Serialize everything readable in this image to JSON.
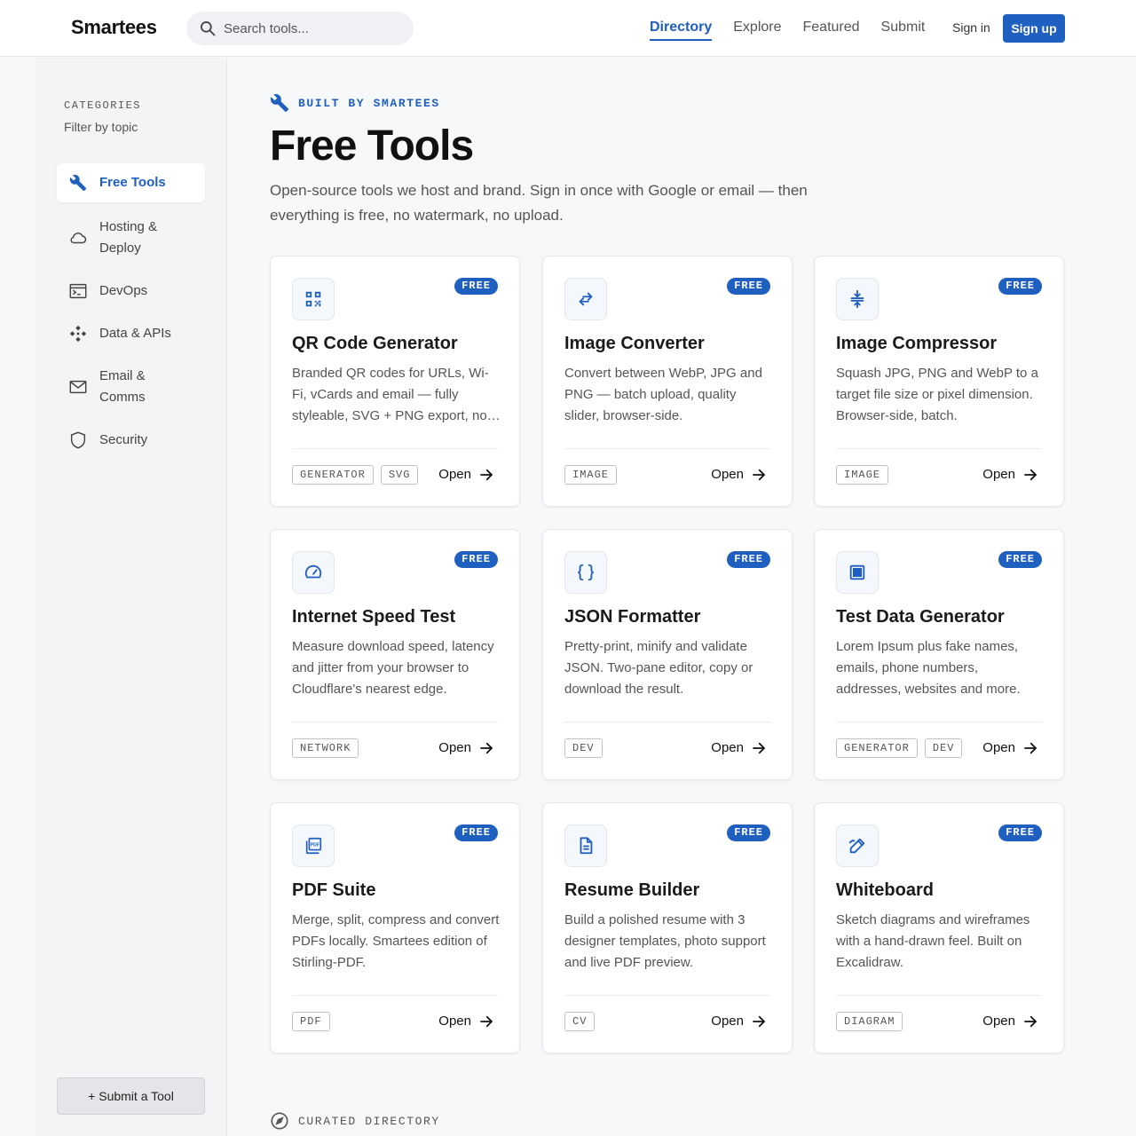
{
  "header": {
    "brand": "Smartees",
    "search_placeholder": "Search tools...",
    "nav": [
      "Directory",
      "Explore",
      "Featured",
      "Submit"
    ],
    "active_nav": "Directory",
    "sign_in": "Sign in",
    "sign_up": "Sign up",
    "accent": "#1f5fbf"
  },
  "sidebar": {
    "label": "CATEGORIES",
    "sublabel": "Filter by topic",
    "items": [
      {
        "label": "Free Tools",
        "icon": "wrench-icon",
        "active": true
      },
      {
        "label": "Hosting & Deploy",
        "icon": "cloud-icon",
        "active": false
      },
      {
        "label": "DevOps",
        "icon": "terminal-icon",
        "active": false
      },
      {
        "label": "Data & APIs",
        "icon": "api-icon",
        "active": false
      },
      {
        "label": "Email & Comms",
        "icon": "mail-icon",
        "active": false
      },
      {
        "label": "Security",
        "icon": "shield-icon",
        "active": false
      }
    ],
    "submit_button": "+ Submit a Tool"
  },
  "hero": {
    "eyebrow": "BUILT BY SMARTEES",
    "title": "Free Tools",
    "subtitle": "Open-source tools we host and brand. Sign in once with Google or email — then everything is free, no watermark, no upload."
  },
  "cards": [
    {
      "title": "QR Code Generator",
      "icon": "qr-code-icon",
      "badge": "FREE",
      "desc": "Branded QR codes for URLs, Wi-Fi, vCards and email — fully styleable, SVG + PNG export, no watermark.",
      "tags": [
        "GENERATOR",
        "SVG"
      ],
      "open": "Open"
    },
    {
      "title": "Image Converter",
      "icon": "swap-arrows-icon",
      "badge": "FREE",
      "desc": "Convert between WebP, JPG and PNG — batch upload, quality slider, browser-side.",
      "tags": [
        "IMAGE"
      ],
      "open": "Open"
    },
    {
      "title": "Image Compressor",
      "icon": "compress-icon",
      "badge": "FREE",
      "desc": "Squash JPG, PNG and WebP to a target file size or pixel dimension. Browser-side, batch.",
      "tags": [
        "IMAGE"
      ],
      "open": "Open"
    },
    {
      "title": "Internet Speed Test",
      "icon": "speedometer-icon",
      "badge": "FREE",
      "desc": "Measure download speed, latency and jitter from your browser to Cloudflare's nearest edge.",
      "tags": [
        "NETWORK"
      ],
      "open": "Open"
    },
    {
      "title": "JSON Formatter",
      "icon": "braces-icon",
      "badge": "FREE",
      "desc": "Pretty-print, minify and validate JSON. Two-pane editor, copy or download the result.",
      "tags": [
        "DEV"
      ],
      "open": "Open"
    },
    {
      "title": "Test Data Generator",
      "icon": "grid-icon",
      "badge": "FREE",
      "desc": "Lorem Ipsum plus fake names, emails, phone numbers, addresses, websites and more.",
      "tags": [
        "GENERATOR",
        "DEV"
      ],
      "open": "Open"
    },
    {
      "title": "PDF Suite",
      "icon": "pdf-icon",
      "badge": "FREE",
      "desc": "Merge, split, compress and convert PDFs locally. Smartees edition of Stirling-PDF.",
      "tags": [
        "PDF"
      ],
      "open": "Open"
    },
    {
      "title": "Resume Builder",
      "icon": "document-icon",
      "badge": "FREE",
      "desc": "Build a polished resume with 3 designer templates, photo support and live PDF preview.",
      "tags": [
        "CV"
      ],
      "open": "Open"
    },
    {
      "title": "Whiteboard",
      "icon": "pen-icon",
      "badge": "FREE",
      "desc": "Sketch diagrams and wireframes with a hand-drawn feel. Built on Excalidraw.",
      "tags": [
        "DIAGRAM"
      ],
      "open": "Open"
    }
  ],
  "section2": {
    "eyebrow": "CURATED DIRECTORY",
    "icon": "compass-icon"
  }
}
